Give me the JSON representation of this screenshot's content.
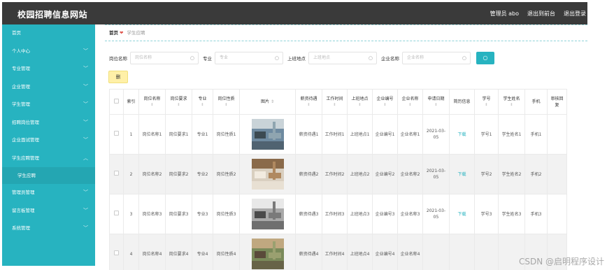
{
  "header": {
    "title": "校园招聘信息网站",
    "admin_label": "管理员 abo",
    "front_link": "退出到前台",
    "logout_link": "退出登录"
  },
  "sidebar": {
    "items": [
      {
        "label": "首页",
        "chevron": false
      },
      {
        "label": "个人中心",
        "chevron": true
      },
      {
        "label": "专业管理",
        "chevron": true
      },
      {
        "label": "企业管理",
        "chevron": true
      },
      {
        "label": "学生管理",
        "chevron": true
      },
      {
        "label": "招聘岗位管理",
        "chevron": true
      },
      {
        "label": "企业面试管理",
        "chevron": true
      },
      {
        "label": "学生应聘管理",
        "chevron": true,
        "open": true
      },
      {
        "label": "管理员管理",
        "chevron": true
      },
      {
        "label": "留言板管理",
        "chevron": true
      },
      {
        "label": "系统管理",
        "chevron": true
      }
    ],
    "sub_item": "学生应聘"
  },
  "breadcrumb": {
    "home": "首页",
    "separator": "❤",
    "current": "学生应聘"
  },
  "search": {
    "fields": [
      {
        "label": "岗位名称",
        "placeholder": "岗位名称"
      },
      {
        "label": "专业",
        "placeholder": "专业"
      },
      {
        "label": "上班地点",
        "placeholder": "上班地点"
      },
      {
        "label": "企业名称",
        "placeholder": "企业名称"
      }
    ],
    "button_icon": "search-icon"
  },
  "delete_label": "删",
  "table": {
    "headers": [
      "",
      "索引",
      "岗位名称",
      "岗位要求",
      "专业",
      "岗位性质",
      "图片",
      "薪资待遇",
      "工作时间",
      "上班地点",
      "企业编号",
      "企业名称",
      "申请日期",
      "简历信息",
      "学号",
      "学生姓名",
      "手机",
      "审核回复"
    ],
    "rows": [
      [
        "",
        "1",
        "岗位名称1",
        "岗位要求1",
        "专业1",
        "岗位性质1",
        "",
        "薪资待遇1",
        "工作时间1",
        "上班地点1",
        "企业编号1",
        "企业名称1",
        "2021-03-05",
        "下载",
        "学号1",
        "学生姓名1",
        "手机1",
        ""
      ],
      [
        "",
        "2",
        "岗位名称2",
        "岗位要求2",
        "专业2",
        "岗位性质2",
        "",
        "薪资待遇2",
        "工作时间2",
        "上班地点2",
        "企业编号2",
        "企业名称2",
        "2021-03-05",
        "下载",
        "学号2",
        "学生姓名2",
        "手机2",
        ""
      ],
      [
        "",
        "3",
        "岗位名称3",
        "岗位要求3",
        "专业3",
        "岗位性质3",
        "",
        "薪资待遇3",
        "工作时间3",
        "上班地点3",
        "企业编号3",
        "企业名称3",
        "2021-03-05",
        "下载",
        "学号3",
        "学生姓名3",
        "手机3",
        ""
      ],
      [
        "",
        "4",
        "岗位名称4",
        "岗位要求4",
        "专业4",
        "岗位性质4",
        "",
        "薪资待遇4",
        "工作时间4",
        "上班地点4",
        "企业编号4",
        "企业名称4",
        "",
        "",
        "",
        "",
        "",
        ""
      ]
    ]
  },
  "watermark": "CSDN @启明程序设计"
}
